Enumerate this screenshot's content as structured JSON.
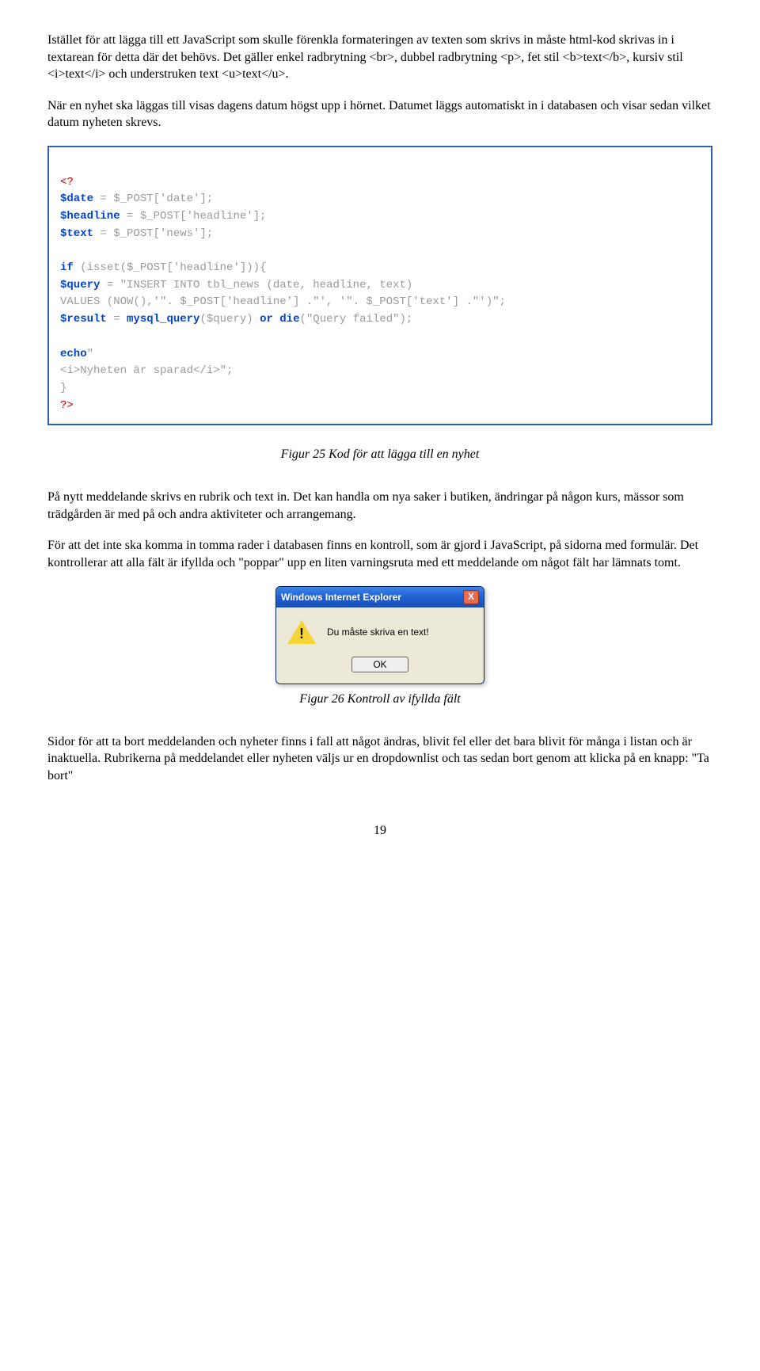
{
  "para1": "Istället för att lägga till ett JavaScript som skulle förenkla formateringen av texten som skrivs in måste html-kod skrivas in i textarean för detta där det behövs. Det gäller enkel radbrytning <br>, dubbel radbrytning <p>, fet stil <b>text</b>, kursiv stil <i>text</i> och understruken text <u>text</u>.",
  "para2": "När en nyhet ska läggas till visas dagens datum högst upp i hörnet. Datumet läggs automatiskt in i databasen och visar sedan vilket datum nyheten skrevs.",
  "code": {
    "open": "<?",
    "l1a": "$date",
    "l1b": " = $_POST['date'];",
    "l2a": "$headline",
    "l2b": " = $_POST['headline'];",
    "l3a": "$text",
    "l3b": " = $_POST['news'];",
    "l4a": "if ",
    "l4b": "(isset(",
    "l4c": "$_POST['headline']",
    "l4d": ")){",
    "l5a": "$query",
    "l5b": " = \"INSERT INTO tbl_news (date, headline, text)",
    "l6": "VALUES (NOW(),'\". $_POST['headline'] .\"', '\". $_POST['text'] .\"')\";",
    "l7a": "$result",
    "l7b": " = ",
    "l7c": "mysql_query",
    "l7d": "($query) ",
    "l7e": "or die",
    "l7f": "(\"Query failed\");",
    "l8": "echo",
    "l8b": "\"",
    "l9": "<i>Nyheten är sparad</i>\";",
    "l10": "}",
    "close": "?>"
  },
  "caption1": "Figur 25 Kod för att lägga till en nyhet",
  "para3": "På nytt meddelande skrivs en rubrik och text in. Det kan handla om nya saker i butiken, ändringar på någon kurs, mässor som trädgården är med på och andra aktiviteter och arrangemang.",
  "para4": "För att det inte ska komma in tomma rader i databasen finns en kontroll, som är gjord i JavaScript, på sidorna med formulär. Det kontrollerar att alla fält är ifyllda och \"poppar\" upp en liten varningsruta med ett meddelande om något fält har lämnats tomt.",
  "dialog": {
    "title": "Windows Internet Explorer",
    "close": "X",
    "message": "Du måste skriva en text!",
    "ok": "OK"
  },
  "caption2": "Figur 26 Kontroll av ifyllda fält",
  "para5": "Sidor för att ta bort meddelanden och nyheter finns i fall att något ändras, blivit fel eller det bara blivit för många i listan och är inaktuella. Rubrikerna på meddelandet eller nyheten väljs ur en dropdownlist och tas sedan bort genom att klicka på en knapp: \"Ta bort\"",
  "page": "19"
}
